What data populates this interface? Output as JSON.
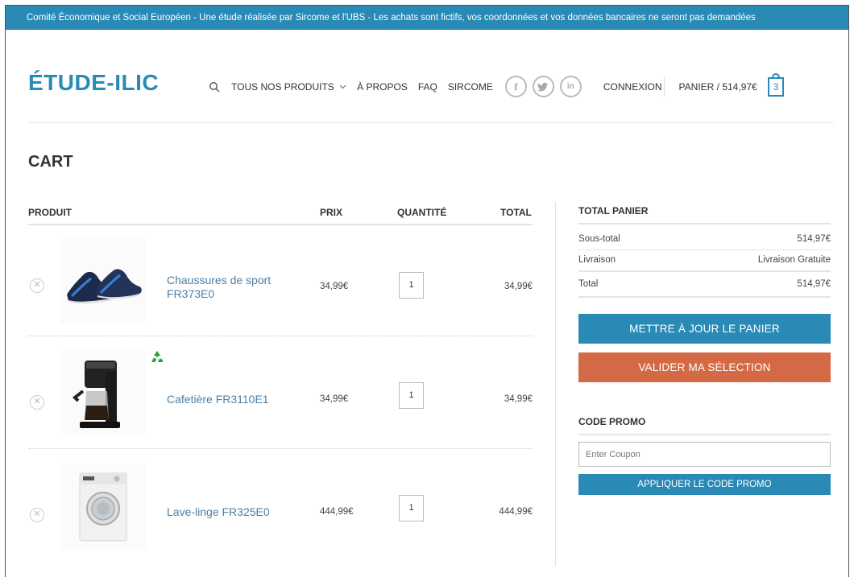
{
  "topbar": {
    "text": "Comité Économique et Social Européen - Une étude réalisée par Sircome et l'UBS - Les achats sont fictifs, vos coordonnées et vos données bancaires ne seront pas demandées"
  },
  "header": {
    "logo": "ÉTUDE-ILIC",
    "nav": {
      "products": "TOUS NOS PRODUITS",
      "about": "À PROPOS",
      "faq": "FAQ",
      "sircome": "SIRCOME",
      "login": "CONNEXION",
      "cart_label": "PANIER / 514,97€",
      "cart_count": "3"
    },
    "social": {
      "facebook": "f",
      "twitter": "t",
      "linkedin": "in"
    }
  },
  "page": {
    "title": "CART"
  },
  "table": {
    "headers": {
      "product": "PRODUIT",
      "price": "PRIX",
      "quantity": "QUANTITÉ",
      "total": "TOTAL"
    },
    "rows": [
      {
        "name_line1": "Chaussures de sport",
        "name_line2": "FR373E0",
        "price": "34,99€",
        "qty": "1",
        "total": "34,99€"
      },
      {
        "name_line1": "Cafetière FR3110E1",
        "name_line2": "",
        "price": "34,99€",
        "qty": "1",
        "total": "34,99€"
      },
      {
        "name_line1": "Lave-linge FR325E0",
        "name_line2": "",
        "price": "444,99€",
        "qty": "1",
        "total": "444,99€"
      }
    ]
  },
  "summary": {
    "title": "TOTAL PANIER",
    "subtotal_label": "Sous-total",
    "subtotal_value": "514,97€",
    "shipping_label": "Livraison",
    "shipping_value": "Livraison Gratuite",
    "total_label": "Total",
    "total_value": "514,97€",
    "update_button": "METTRE À JOUR LE PANIER",
    "checkout_button": "VALIDER MA SÉLECTION"
  },
  "promo": {
    "title": "CODE PROMO",
    "placeholder": "Enter Coupon",
    "apply_button": "APPLIQUER LE CODE PROMO"
  },
  "colors": {
    "accent": "#2a8ab6",
    "checkout": "#d46a45"
  }
}
